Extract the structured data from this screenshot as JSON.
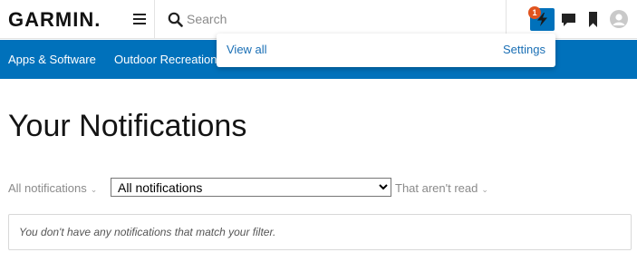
{
  "header": {
    "logo_text": "GARMIN.",
    "search": {
      "placeholder": "Search",
      "value": ""
    },
    "alerts_badge_count": "1",
    "icons": [
      "menu-icon",
      "search-icon",
      "lightning-icon",
      "chat-bubble-icon",
      "bookmark-icon",
      "user-avatar-icon"
    ]
  },
  "nav": {
    "items": [
      {
        "label": "Apps & Software"
      },
      {
        "label": "Outdoor Recreation"
      }
    ]
  },
  "alerts_dropdown": {
    "view_all_label": "View all",
    "settings_label": "Settings"
  },
  "main": {
    "title": "Your Notifications",
    "filter": {
      "left_label": "All notifications",
      "select_value": "All notifications",
      "right_label": "That aren't read"
    },
    "empty_message": "You don't have any notifications that match your filter."
  },
  "colors": {
    "accent": "#0071bb",
    "badge": "#e0541f",
    "link": "#1a6fb5"
  }
}
